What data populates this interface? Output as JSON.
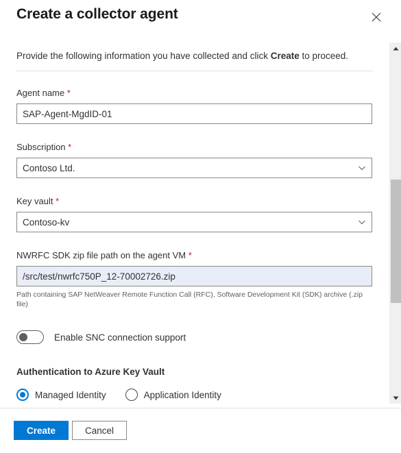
{
  "header": {
    "title": "Create a collector agent",
    "close_icon": "close-icon"
  },
  "intro": {
    "before": "Provide the following information you have collected and click ",
    "emphasis": "Create",
    "after": " to proceed."
  },
  "form": {
    "agent_name": {
      "label": "Agent name",
      "required_marker": "*",
      "value": "SAP-Agent-MgdID-01",
      "placeholder": ""
    },
    "subscription": {
      "label": "Subscription",
      "required_marker": "*",
      "value": "Contoso Ltd.",
      "chevron_icon": "chevron-down-icon"
    },
    "key_vault": {
      "label": "Key vault",
      "required_marker": "*",
      "value": "Contoso-kv",
      "chevron_icon": "chevron-down-icon"
    },
    "sdk_path": {
      "label": "NWRFC SDK zip file path on the agent VM",
      "required_marker": "*",
      "value": "/src/test/nwrfc750P_12-70002726.zip",
      "placeholder": "",
      "help": "Path containing SAP NetWeaver Remote Function Call (RFC), Software Development Kit (SDK) archive (.zip file)",
      "highlight_color": "#e8edf8"
    },
    "snc_toggle": {
      "label": "Enable SNC connection support",
      "state": "off"
    },
    "auth_section": {
      "title": "Authentication to Azure Key Vault",
      "options": [
        {
          "label": "Managed Identity",
          "selected": true
        },
        {
          "label": "Application Identity",
          "selected": false
        }
      ]
    }
  },
  "scrollbar": {
    "up_arrow_icon": "triangle-up-icon",
    "down_arrow_icon": "triangle-down-icon"
  },
  "footer": {
    "create_label": "Create",
    "cancel_label": "Cancel"
  },
  "colors": {
    "accent": "#0078d4",
    "required": "#a4262c",
    "border": "#8a8886",
    "text": "#323130"
  }
}
